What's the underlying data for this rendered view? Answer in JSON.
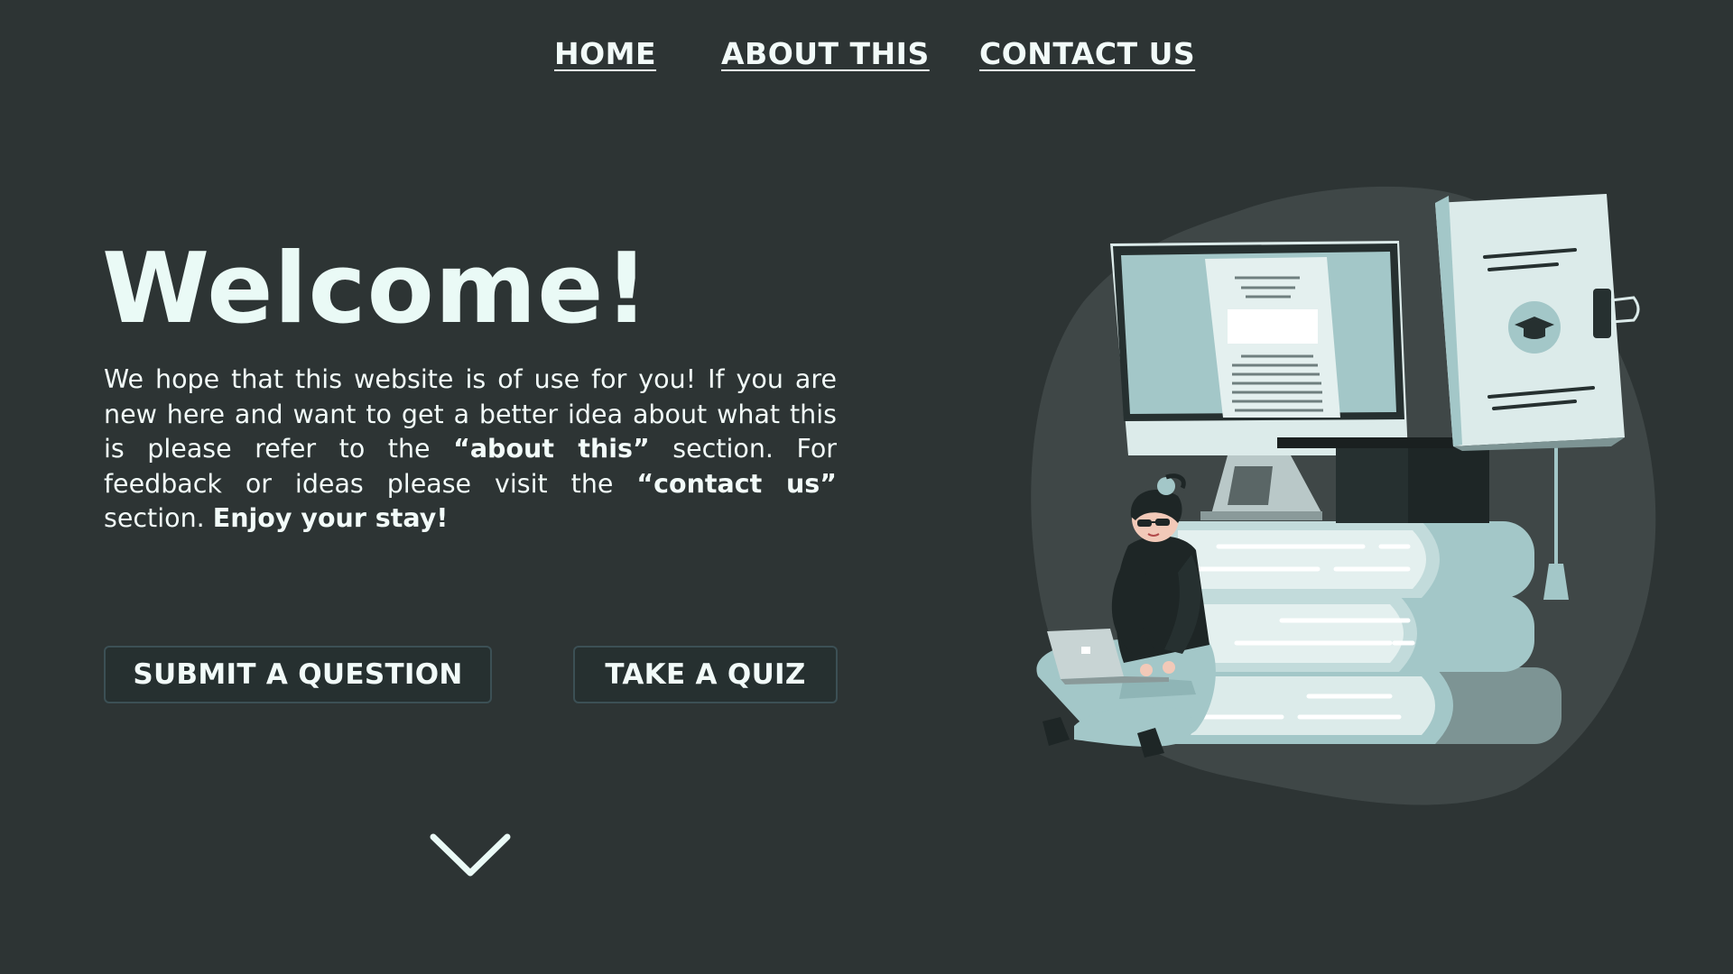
{
  "nav": {
    "home": "HOME",
    "about": "ABOUT THIS",
    "contact": "CONTACT US"
  },
  "hero": {
    "title": "Welcome!",
    "intro": {
      "part1": "We hope that this website is of use for you! If you are new here and want to get a better idea about what this is please refer to the ",
      "about_ref": "“about this”",
      "part2": " section. For feedback or ideas please visit the ",
      "contact_ref": "“contact us”",
      "part3": " section. ",
      "closing": "Enjoy your stay!"
    }
  },
  "buttons": {
    "submit": "SUBMIT A QUESTION",
    "quiz": "TAKE A QUIZ"
  },
  "icons": {
    "scroll": "chevron-down-icon"
  },
  "colors": {
    "background": "#2d3434",
    "text": "#f2fbf9",
    "button_bg": "#263030",
    "button_border": "#3c5055",
    "accent": "#a3c7c8"
  }
}
